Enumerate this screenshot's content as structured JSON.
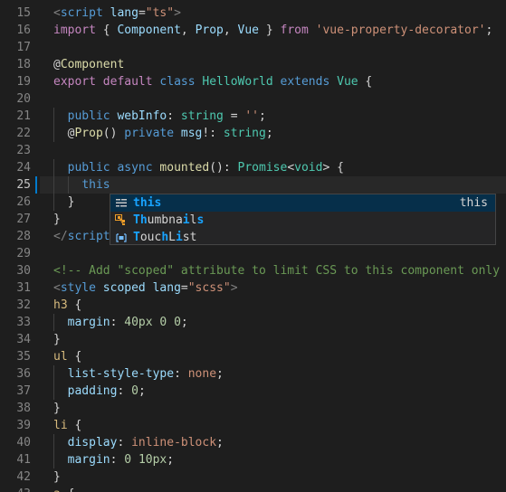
{
  "editor": {
    "current_line": "25",
    "lines": [
      {
        "num": "15",
        "segs": [
          [
            "t-punct",
            "<"
          ],
          [
            "t-tag",
            "script"
          ],
          [
            "t-default",
            " "
          ],
          [
            "t-attr",
            "lang"
          ],
          [
            "t-default",
            "="
          ],
          [
            "t-string",
            "\"ts\""
          ],
          [
            "t-punct",
            ">"
          ]
        ]
      },
      {
        "num": "16",
        "segs": [
          [
            "t-keyword",
            "import"
          ],
          [
            "t-default",
            " { "
          ],
          [
            "t-var",
            "Component"
          ],
          [
            "t-default",
            ", "
          ],
          [
            "t-var",
            "Prop"
          ],
          [
            "t-default",
            ", "
          ],
          [
            "t-var",
            "Vue"
          ],
          [
            "t-default",
            " } "
          ],
          [
            "t-keyword",
            "from"
          ],
          [
            "t-default",
            " "
          ],
          [
            "t-string",
            "'vue-property-decorator'"
          ],
          [
            "t-default",
            ";"
          ]
        ]
      },
      {
        "num": "17",
        "segs": []
      },
      {
        "num": "18",
        "segs": [
          [
            "t-default",
            "@"
          ],
          [
            "t-func",
            "Component"
          ]
        ]
      },
      {
        "num": "19",
        "segs": [
          [
            "t-keyword",
            "export"
          ],
          [
            "t-default",
            " "
          ],
          [
            "t-keyword",
            "default"
          ],
          [
            "t-default",
            " "
          ],
          [
            "t-storage",
            "class"
          ],
          [
            "t-default",
            " "
          ],
          [
            "t-class",
            "HelloWorld"
          ],
          [
            "t-default",
            " "
          ],
          [
            "t-storage",
            "extends"
          ],
          [
            "t-default",
            " "
          ],
          [
            "t-class",
            "Vue"
          ],
          [
            "t-default",
            " {"
          ]
        ]
      },
      {
        "num": "20",
        "segs": []
      },
      {
        "num": "21",
        "segs": [
          [
            "t-default",
            "  "
          ],
          [
            "t-storage",
            "public"
          ],
          [
            "t-default",
            " "
          ],
          [
            "t-var",
            "webInfo"
          ],
          [
            "t-default",
            ": "
          ],
          [
            "t-class",
            "string"
          ],
          [
            "t-default",
            " = "
          ],
          [
            "t-string",
            "''"
          ],
          [
            "t-default",
            ";"
          ]
        ]
      },
      {
        "num": "22",
        "segs": [
          [
            "t-default",
            "  @"
          ],
          [
            "t-func",
            "Prop"
          ],
          [
            "t-default",
            "() "
          ],
          [
            "t-storage",
            "private"
          ],
          [
            "t-default",
            " "
          ],
          [
            "t-var",
            "msg"
          ],
          [
            "t-default",
            "!: "
          ],
          [
            "t-class",
            "string"
          ],
          [
            "t-default",
            ";"
          ]
        ]
      },
      {
        "num": "23",
        "segs": []
      },
      {
        "num": "24",
        "segs": [
          [
            "t-default",
            "  "
          ],
          [
            "t-storage",
            "public"
          ],
          [
            "t-default",
            " "
          ],
          [
            "t-storage",
            "async"
          ],
          [
            "t-default",
            " "
          ],
          [
            "t-func",
            "mounted"
          ],
          [
            "t-default",
            "(): "
          ],
          [
            "t-class",
            "Promise"
          ],
          [
            "t-default",
            "<"
          ],
          [
            "t-class",
            "void"
          ],
          [
            "t-default",
            "> {"
          ]
        ]
      },
      {
        "num": "25",
        "segs": [
          [
            "t-default",
            "    "
          ],
          [
            "t-storage",
            "this"
          ]
        ]
      },
      {
        "num": "26",
        "segs": [
          [
            "t-default",
            "  }"
          ]
        ]
      },
      {
        "num": "27",
        "segs": [
          [
            "t-default",
            "}"
          ]
        ]
      },
      {
        "num": "28",
        "segs": [
          [
            "t-punct",
            "</"
          ],
          [
            "t-tag",
            "script"
          ]
        ]
      },
      {
        "num": "29",
        "segs": []
      },
      {
        "num": "30",
        "segs": [
          [
            "t-comment",
            "<!-- Add \"scoped\" attribute to limit CSS to this component only -->"
          ]
        ]
      },
      {
        "num": "31",
        "segs": [
          [
            "t-punct",
            "<"
          ],
          [
            "t-tag",
            "style"
          ],
          [
            "t-default",
            " "
          ],
          [
            "t-attr",
            "scoped"
          ],
          [
            "t-default",
            " "
          ],
          [
            "t-attr",
            "lang"
          ],
          [
            "t-default",
            "="
          ],
          [
            "t-string",
            "\"scss\""
          ],
          [
            "t-punct",
            ">"
          ]
        ]
      },
      {
        "num": "32",
        "segs": [
          [
            "t-selector",
            "h3"
          ],
          [
            "t-default",
            " {"
          ]
        ]
      },
      {
        "num": "33",
        "segs": [
          [
            "t-default",
            "  "
          ],
          [
            "t-attr",
            "margin"
          ],
          [
            "t-default",
            ": "
          ],
          [
            "t-number",
            "40px"
          ],
          [
            "t-default",
            " "
          ],
          [
            "t-number",
            "0"
          ],
          [
            "t-default",
            " "
          ],
          [
            "t-number",
            "0"
          ],
          [
            "t-default",
            ";"
          ]
        ]
      },
      {
        "num": "34",
        "segs": [
          [
            "t-default",
            "}"
          ]
        ]
      },
      {
        "num": "35",
        "segs": [
          [
            "t-selector",
            "ul"
          ],
          [
            "t-default",
            " {"
          ]
        ]
      },
      {
        "num": "36",
        "segs": [
          [
            "t-default",
            "  "
          ],
          [
            "t-attr",
            "list-style-type"
          ],
          [
            "t-default",
            ": "
          ],
          [
            "t-string",
            "none"
          ],
          [
            "t-default",
            ";"
          ]
        ]
      },
      {
        "num": "37",
        "segs": [
          [
            "t-default",
            "  "
          ],
          [
            "t-attr",
            "padding"
          ],
          [
            "t-default",
            ": "
          ],
          [
            "t-number",
            "0"
          ],
          [
            "t-default",
            ";"
          ]
        ]
      },
      {
        "num": "38",
        "segs": [
          [
            "t-default",
            "}"
          ]
        ]
      },
      {
        "num": "39",
        "segs": [
          [
            "t-selector",
            "li"
          ],
          [
            "t-default",
            " {"
          ]
        ]
      },
      {
        "num": "40",
        "segs": [
          [
            "t-default",
            "  "
          ],
          [
            "t-attr",
            "display"
          ],
          [
            "t-default",
            ": "
          ],
          [
            "t-string",
            "inline-block"
          ],
          [
            "t-default",
            ";"
          ]
        ]
      },
      {
        "num": "41",
        "segs": [
          [
            "t-default",
            "  "
          ],
          [
            "t-attr",
            "margin"
          ],
          [
            "t-default",
            ": "
          ],
          [
            "t-number",
            "0"
          ],
          [
            "t-default",
            " "
          ],
          [
            "t-number",
            "10px"
          ],
          [
            "t-default",
            ";"
          ]
        ]
      },
      {
        "num": "42",
        "segs": [
          [
            "t-default",
            "}"
          ]
        ]
      },
      {
        "num": "43",
        "segs": [
          [
            "t-selector",
            "a"
          ],
          [
            "t-default",
            " {"
          ]
        ]
      }
    ]
  },
  "suggest": {
    "items": [
      {
        "icon": "keyword-icon",
        "parts": [
          [
            "hl",
            "this"
          ]
        ],
        "detail": "this"
      },
      {
        "icon": "class-icon",
        "parts": [
          [
            "hl",
            "Th"
          ],
          [
            "n",
            "umbna"
          ],
          [
            "hl",
            "i"
          ],
          [
            "n",
            "l"
          ],
          [
            "hl",
            "s"
          ]
        ],
        "detail": ""
      },
      {
        "icon": "variable-icon",
        "parts": [
          [
            "hl",
            "T"
          ],
          [
            "n",
            "ouc"
          ],
          [
            "hl",
            "h"
          ],
          [
            "n",
            "L"
          ],
          [
            "hl",
            "i"
          ],
          [
            "n",
            "st"
          ]
        ],
        "detail": ""
      }
    ]
  },
  "colors": {
    "background": "#1e1e1e",
    "suggest_background": "#252526",
    "suggest_selected": "#062f4a",
    "match_highlight": "#18a3ff"
  }
}
